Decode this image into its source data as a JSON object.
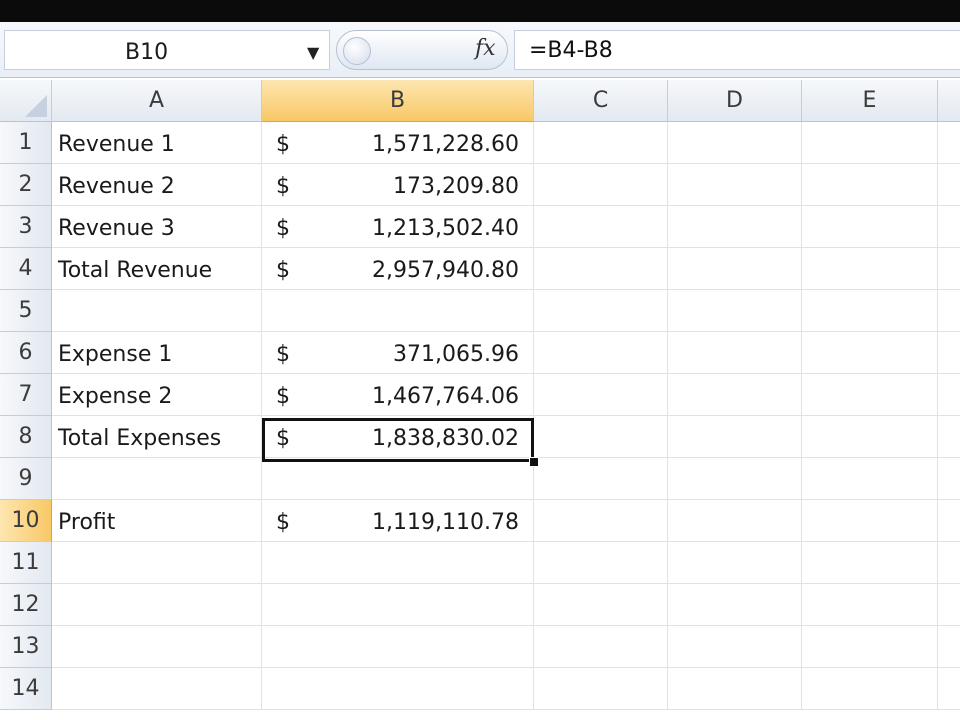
{
  "formula_bar": {
    "name_box": "B10",
    "fx_label": "fx",
    "formula": "=B4-B8"
  },
  "columns": [
    "A",
    "B",
    "C",
    "D",
    "E"
  ],
  "selected_column": "B",
  "selected_row": "10",
  "rows": [
    {
      "num": "1",
      "label": "Revenue 1",
      "currency": "$",
      "amount": "1,571,228.60"
    },
    {
      "num": "2",
      "label": "Revenue 2",
      "currency": "$",
      "amount": "173,209.80"
    },
    {
      "num": "3",
      "label": "Revenue 3",
      "currency": "$",
      "amount": "1,213,502.40"
    },
    {
      "num": "4",
      "label": "Total Revenue",
      "currency": "$",
      "amount": "2,957,940.80"
    },
    {
      "num": "5",
      "label": "",
      "currency": "",
      "amount": ""
    },
    {
      "num": "6",
      "label": "Expense 1",
      "currency": "$",
      "amount": "371,065.96"
    },
    {
      "num": "7",
      "label": "Expense 2",
      "currency": "$",
      "amount": "1,467,764.06"
    },
    {
      "num": "8",
      "label": "Total Expenses",
      "currency": "$",
      "amount": "1,838,830.02"
    },
    {
      "num": "9",
      "label": "",
      "currency": "",
      "amount": ""
    },
    {
      "num": "10",
      "label": "Profit",
      "currency": "$",
      "amount": "1,119,110.78"
    },
    {
      "num": "11",
      "label": "",
      "currency": "",
      "amount": ""
    },
    {
      "num": "12",
      "label": "",
      "currency": "",
      "amount": ""
    },
    {
      "num": "13",
      "label": "",
      "currency": "",
      "amount": ""
    },
    {
      "num": "14",
      "label": "",
      "currency": "",
      "amount": ""
    }
  ],
  "colors": {
    "selection_header": "#f8c866",
    "grid_line": "#dfe3e8",
    "header_bg": "#e3e9f1"
  }
}
